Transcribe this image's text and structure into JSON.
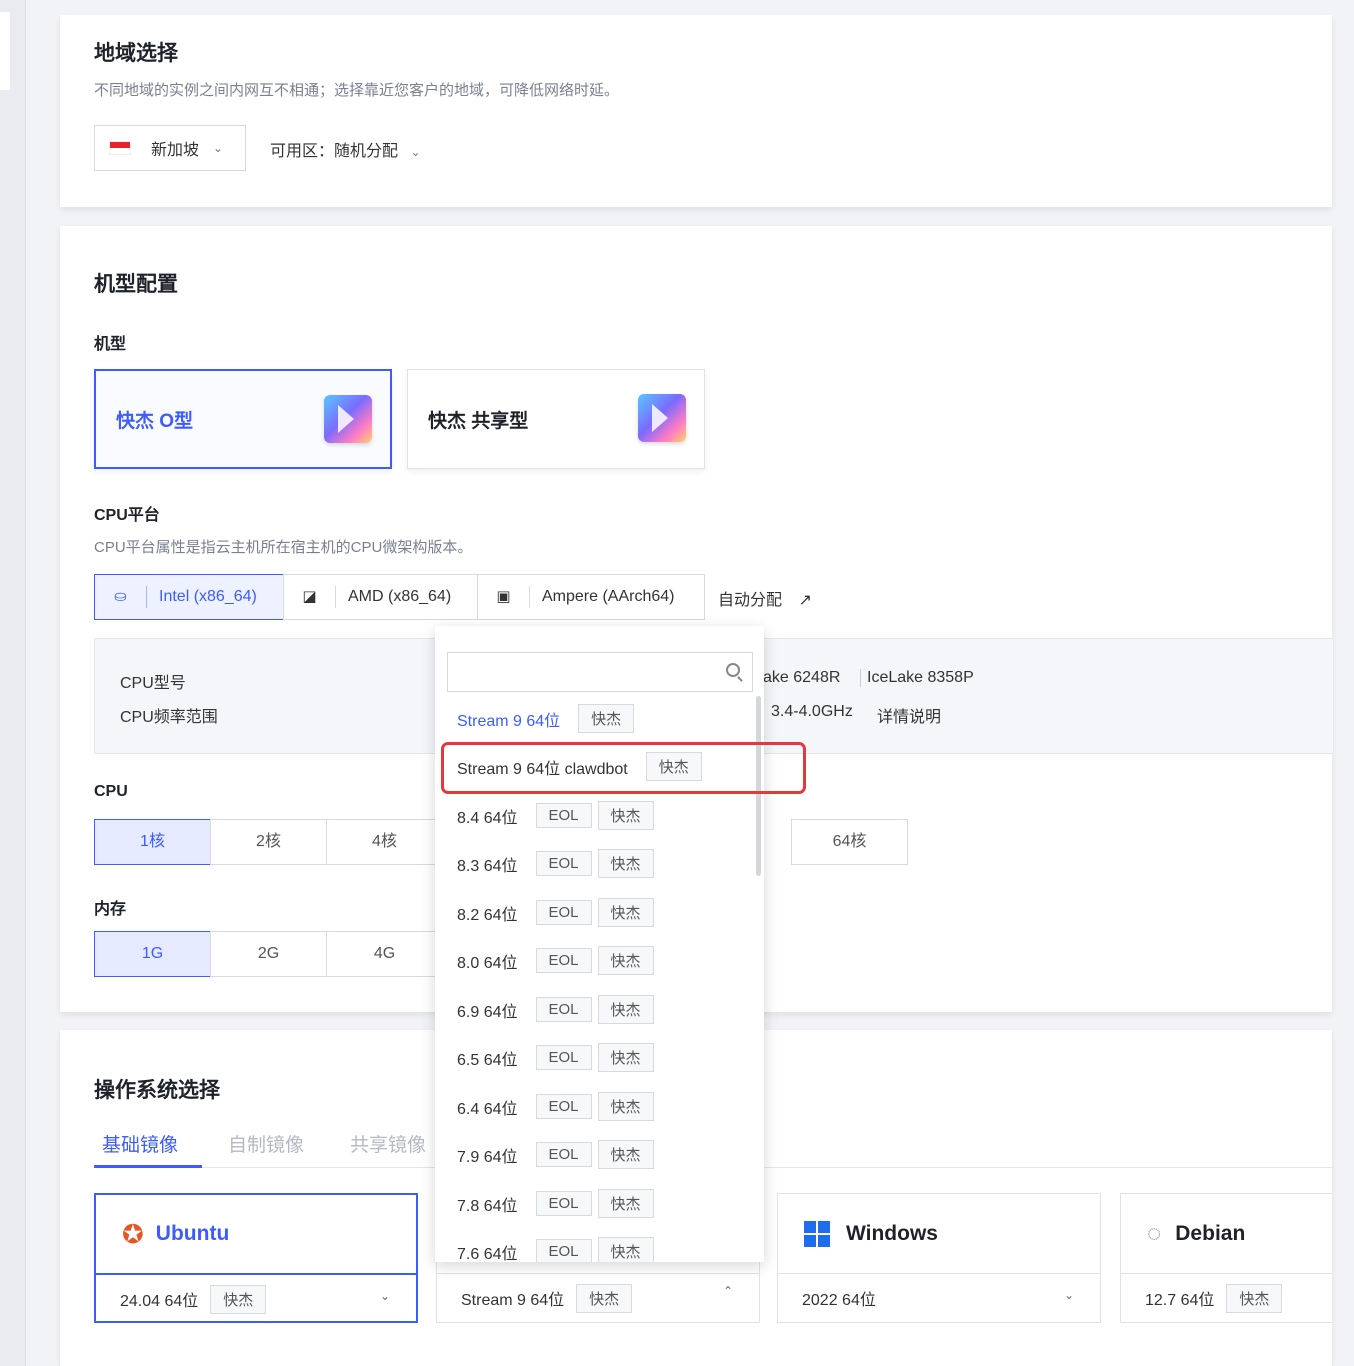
{
  "region": {
    "title": "地域选择",
    "subtitle": "不同地域的实例之间内网互不相通；选择靠近您客户的地域，可降低网络时延。",
    "city": "新加坡",
    "zone_label": "可用区：随机分配"
  },
  "machine": {
    "title": "机型配置",
    "type_label": "机型",
    "types": [
      "快杰 O型",
      "快杰 共享型"
    ],
    "cpu_platform_label": "CPU平台",
    "cpu_platform_desc": "CPU平台属性是指云主机所在宿主机的CPU微架构版本。",
    "platforms": [
      "Intel (x86_64)",
      "AMD (x86_64)",
      "Ampere (AArch64)"
    ],
    "auto_assign": "自动分配",
    "cpu_model_label": "CPU型号",
    "cpu_freq_label": "CPU频率范围",
    "cpu_model_values": [
      "ake 6248R",
      "IceLake 8358P"
    ],
    "cpu_freq_value": "3.4-4.0GHz",
    "detail_link": "详情说明",
    "cpu_label": "CPU",
    "cpu_options": [
      "1核",
      "2核",
      "4核",
      "64核"
    ],
    "mem_label": "内存",
    "mem_options": [
      "1G",
      "2G",
      "4G"
    ]
  },
  "os": {
    "title": "操作系统选择",
    "tabs": [
      "基础镜像",
      "自制镜像",
      "共享镜像"
    ],
    "cards": [
      {
        "name": "Ubuntu",
        "version": "24.04 64位",
        "tag": "快杰"
      },
      {
        "name": "",
        "version": "Stream 9 64位",
        "tag": "快杰"
      },
      {
        "name": "Windows",
        "version": "2022 64位",
        "tag": ""
      },
      {
        "name": "Debian",
        "version": "12.7 64位",
        "tag": "快杰"
      }
    ]
  },
  "dropdown": {
    "search_placeholder": "",
    "items": [
      {
        "label": "Stream 9 64位",
        "tags": [
          "快杰"
        ]
      },
      {
        "label": "Stream 9 64位 clawdbot",
        "tags": [
          "快杰"
        ]
      },
      {
        "label": "8.4 64位",
        "tags": [
          "EOL",
          "快杰"
        ]
      },
      {
        "label": "8.3 64位",
        "tags": [
          "EOL",
          "快杰"
        ]
      },
      {
        "label": "8.2 64位",
        "tags": [
          "EOL",
          "快杰"
        ]
      },
      {
        "label": "8.0 64位",
        "tags": [
          "EOL",
          "快杰"
        ]
      },
      {
        "label": "6.9 64位",
        "tags": [
          "EOL",
          "快杰"
        ]
      },
      {
        "label": "6.5 64位",
        "tags": [
          "EOL",
          "快杰"
        ]
      },
      {
        "label": "6.4 64位",
        "tags": [
          "EOL",
          "快杰"
        ]
      },
      {
        "label": "7.9 64位",
        "tags": [
          "EOL",
          "快杰"
        ]
      },
      {
        "label": "7.8 64位",
        "tags": [
          "EOL",
          "快杰"
        ]
      },
      {
        "label": "7.6 64位",
        "tags": [
          "EOL",
          "快杰"
        ]
      }
    ]
  },
  "colors": {
    "accent": "#3d5cff",
    "highlight": "#e5383b"
  }
}
